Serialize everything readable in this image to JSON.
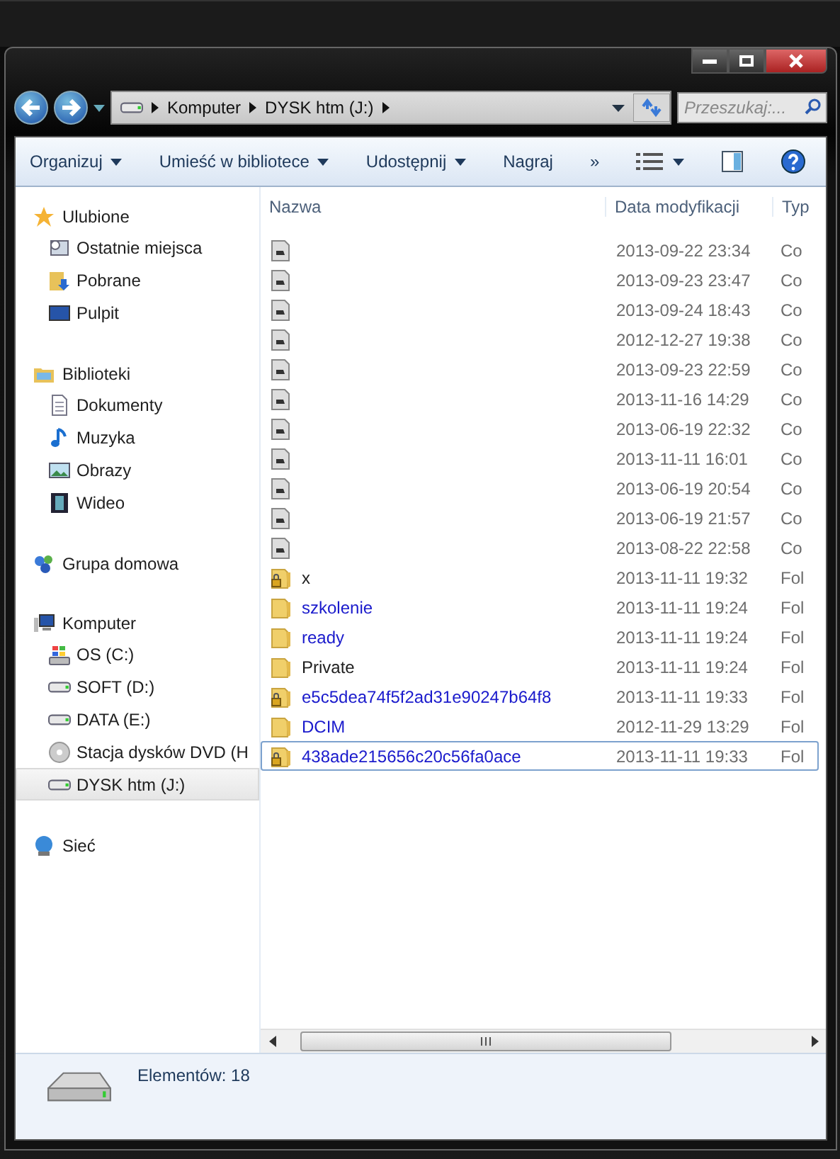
{
  "address_bar": {
    "crumbs": [
      "Komputer",
      "DYSK htm (J:)"
    ]
  },
  "search": {
    "placeholder": "Przeszukaj:..."
  },
  "toolbar": {
    "items": [
      {
        "label": "Organizuj",
        "dropdown": true
      },
      {
        "label": "Umieść w bibliotece",
        "dropdown": true
      },
      {
        "label": "Udostępnij",
        "dropdown": true
      },
      {
        "label": "Nagraj",
        "dropdown": false
      },
      {
        "label": "»",
        "dropdown": false
      }
    ]
  },
  "sidebar": {
    "groups": [
      {
        "label": "Ulubione",
        "children": [
          {
            "label": "Ostatnie miejsca",
            "selected": false
          },
          {
            "label": "Pobrane",
            "selected": false
          },
          {
            "label": "Pulpit",
            "selected": false
          }
        ]
      },
      {
        "label": "Biblioteki",
        "children": [
          {
            "label": "Dokumenty",
            "selected": false
          },
          {
            "label": "Muzyka",
            "selected": false
          },
          {
            "label": "Obrazy",
            "selected": false
          },
          {
            "label": "Wideo",
            "selected": false
          }
        ]
      },
      {
        "label": "Grupa domowa"
      },
      {
        "label": "Komputer",
        "children": [
          {
            "label": "OS (C:)",
            "selected": false
          },
          {
            "label": "SOFT (D:)",
            "selected": false
          },
          {
            "label": "DATA (E:)",
            "selected": false
          },
          {
            "label": "Stacja dysków DVD (H",
            "selected": false
          },
          {
            "label": "DYSK htm (J:)",
            "selected": true
          }
        ]
      },
      {
        "label": "Sieć"
      }
    ]
  },
  "table": {
    "columns": [
      "Nazwa",
      "Data modyfikacji",
      "Typ"
    ],
    "rows": [
      {
        "kind": "file",
        "date": "2013-09-22 23:34",
        "type": "Co",
        "selected": false
      },
      {
        "kind": "file",
        "date": "2013-09-23 23:47",
        "type": "Co",
        "selected": false
      },
      {
        "kind": "file",
        "date": "2013-09-24 18:43",
        "type": "Co",
        "selected": false
      },
      {
        "kind": "file",
        "date": "2012-12-27 19:38",
        "type": "Co",
        "selected": false
      },
      {
        "kind": "file",
        "date": "2013-09-23 22:59",
        "type": "Co",
        "selected": false
      },
      {
        "kind": "file",
        "date": "2013-11-16 14:29",
        "type": "Co",
        "selected": false
      },
      {
        "kind": "file",
        "date": "2013-06-19 22:32",
        "type": "Co",
        "selected": false
      },
      {
        "kind": "file",
        "date": "2013-11-11 16:01",
        "type": "Co",
        "selected": false
      },
      {
        "kind": "file",
        "date": "2013-06-19 20:54",
        "type": "Co",
        "selected": false
      },
      {
        "kind": "file",
        "date": "2013-06-19 21:57",
        "type": "Co",
        "selected": false
      },
      {
        "kind": "file",
        "date": "2013-08-22 22:58",
        "type": "Co",
        "selected": false
      },
      {
        "kind": "folder",
        "name": "x",
        "locked": true,
        "encrypted": false,
        "date": "2013-11-11 19:32",
        "type": "Fol",
        "selected": false
      },
      {
        "kind": "folder",
        "name": "szkolenie",
        "locked": false,
        "encrypted": true,
        "date": "2013-11-11 19:24",
        "type": "Fol",
        "selected": false
      },
      {
        "kind": "folder",
        "name": "ready",
        "locked": false,
        "encrypted": true,
        "date": "2013-11-11 19:24",
        "type": "Fol",
        "selected": false
      },
      {
        "kind": "folder",
        "name": "Private",
        "locked": false,
        "encrypted": false,
        "date": "2013-11-11 19:24",
        "type": "Fol",
        "selected": false
      },
      {
        "kind": "folder",
        "name": "e5c5dea74f5f2ad31e90247b64f8",
        "locked": true,
        "encrypted": true,
        "date": "2013-11-11 19:33",
        "type": "Fol",
        "selected": false
      },
      {
        "kind": "folder",
        "name": "DCIM",
        "locked": false,
        "encrypted": true,
        "date": "2012-11-29 13:29",
        "type": "Fol",
        "selected": false
      },
      {
        "kind": "folder",
        "name": "438ade215656c20c56fa0ace",
        "locked": true,
        "encrypted": true,
        "date": "2013-11-11 19:33",
        "type": "Fol",
        "selected": true
      }
    ]
  },
  "status_bar": {
    "text": "Elementów: 18"
  }
}
